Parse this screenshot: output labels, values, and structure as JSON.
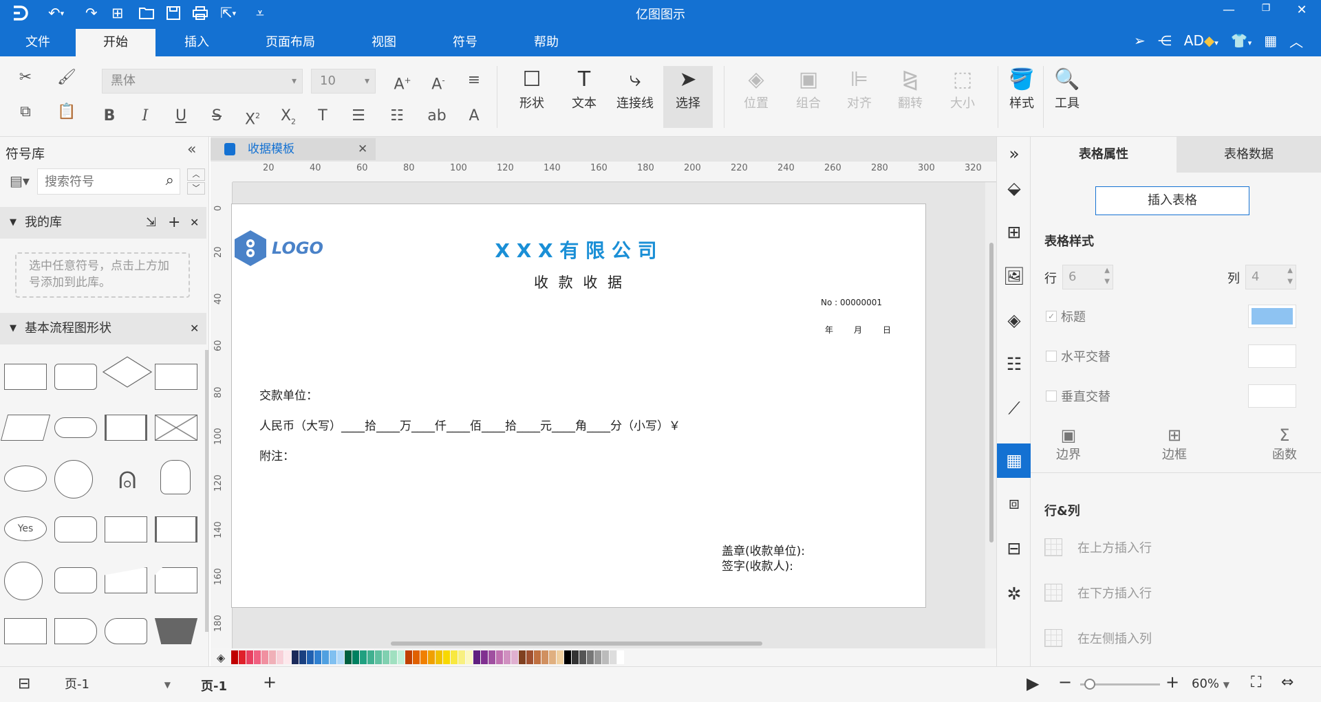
{
  "app": {
    "title": "亿图图示"
  },
  "menu": {
    "tabs": [
      "文件",
      "开始",
      "插入",
      "页面布局",
      "视图",
      "符号",
      "帮助"
    ],
    "active": "开始"
  },
  "user": {
    "initials": "AD"
  },
  "ribbon": {
    "font_family": "黑体",
    "font_size": "10",
    "tools": {
      "shape": "形状",
      "text": "文本",
      "connector": "连接线",
      "select": "选择",
      "position": "位置",
      "group": "组合",
      "align": "对齐",
      "flip": "翻转",
      "size": "大小",
      "style": "样式",
      "tools": "工具"
    }
  },
  "left_panel": {
    "title": "符号库",
    "search_placeholder": "搜索符号",
    "my_library": "我的库",
    "my_library_hint": "选中任意符号，点击上方加号添加到此库。",
    "basic_flowchart": "基本流程图形状",
    "yes_label": "Yes"
  },
  "document": {
    "tab_name": "收据模板",
    "logo_text": "LOGO",
    "company": "X X X 有 限 公 司",
    "receipt_title": "收 款 收 据",
    "number": "No : 00000001",
    "date_line": "年　　月　　日",
    "payer_label": "交款单位：",
    "rmb_line": "人民币（大写）____拾____万____仟____佰____拾____元____角____分（小写）￥",
    "note_label": "附注：",
    "stamp_label": "盖章(收款单位):",
    "sign_label": "签字(收款人):"
  },
  "ruler": {
    "h_ticks": [
      "20",
      "40",
      "60",
      "80",
      "100",
      "120",
      "140",
      "160",
      "180",
      "200",
      "220",
      "240",
      "260",
      "280",
      "300",
      "320"
    ],
    "v_ticks": [
      "0",
      "20",
      "40",
      "60",
      "80",
      "100",
      "120",
      "140",
      "160",
      "180"
    ]
  },
  "right_panel": {
    "tab_props": "表格属性",
    "tab_data": "表格数据",
    "insert_table": "插入表格",
    "table_style": "表格样式",
    "rows_label": "行",
    "rows_value": "6",
    "cols_label": "列",
    "cols_value": "4",
    "header_label": "标题",
    "h_alt_label": "水平交替",
    "v_alt_label": "垂直交替",
    "border_label": "边界",
    "frame_label": "边框",
    "function_label": "函数",
    "rowcol_title": "行&列",
    "insert_above": "在上方插入行",
    "insert_below": "在下方插入行",
    "insert_left": "在左侧插入列",
    "header_color": "#8ec3f2"
  },
  "status": {
    "page_select": "页-1",
    "page_tab": "页-1",
    "zoom": "60%"
  },
  "colors": {
    "accent": "#1471d2",
    "company": "#1a8fd6",
    "logo": "#4a82c8"
  }
}
